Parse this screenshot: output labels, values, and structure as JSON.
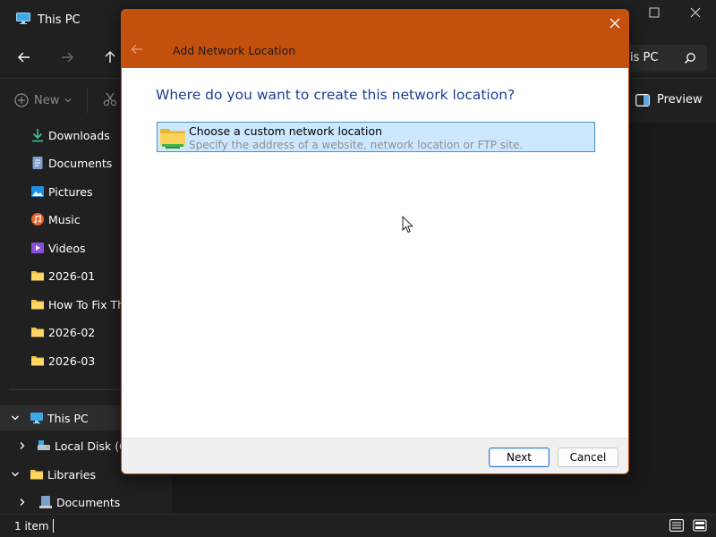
{
  "explorer": {
    "title": "This PC",
    "search_text": "is PC",
    "toolbar": {
      "new_label": "New",
      "preview_label": "Preview"
    },
    "sidebar": {
      "items": [
        {
          "label": "Downloads",
          "icon": "download-icon"
        },
        {
          "label": "Documents",
          "icon": "documents-icon"
        },
        {
          "label": "Pictures",
          "icon": "pictures-icon"
        },
        {
          "label": "Music",
          "icon": "music-icon"
        },
        {
          "label": "Videos",
          "icon": "videos-icon"
        },
        {
          "label": "2026-01",
          "icon": "folder-icon"
        },
        {
          "label": "How To Fix Thu",
          "icon": "folder-icon"
        },
        {
          "label": "2026-02",
          "icon": "folder-icon"
        },
        {
          "label": "2026-03",
          "icon": "folder-icon"
        }
      ],
      "tree": [
        {
          "label": "This PC",
          "icon": "computer-icon",
          "expanded": true,
          "selected": true
        },
        {
          "label": "Local Disk (C:)",
          "icon": "drive-icon",
          "expanded": false
        },
        {
          "label": "Libraries",
          "icon": "folder-icon",
          "expanded": true
        },
        {
          "label": "Documents",
          "icon": "library-documents-icon",
          "expanded": false
        }
      ]
    },
    "status": {
      "item_count": "1 item"
    }
  },
  "dialog": {
    "title": "Add Network Location",
    "heading": "Where do you want to create this network location?",
    "option": {
      "title": "Choose a custom network location",
      "subtitle": "Specify the address of a website, network location or FTP site."
    },
    "buttons": {
      "next": "Next",
      "cancel": "Cancel"
    }
  },
  "colors": {
    "dialog_header": "#c4500e",
    "heading_blue": "#1a3e9b",
    "selection_fill": "#cce8ff",
    "selection_border": "#4a90c8",
    "explorer_bg": "#202020"
  }
}
